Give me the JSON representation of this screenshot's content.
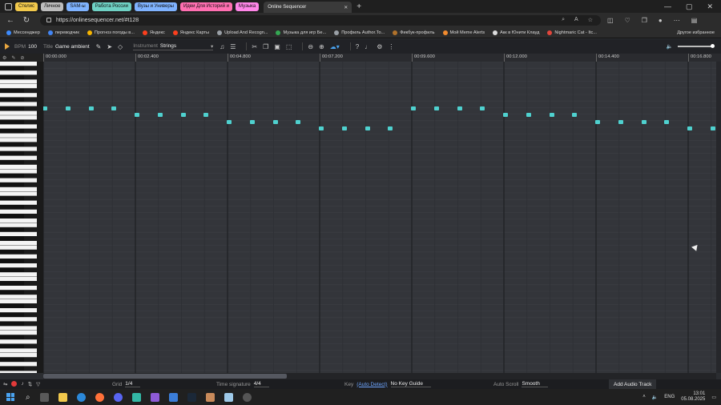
{
  "browser": {
    "tab_groups": [
      {
        "label": "Стелис",
        "color": "#f2c94c"
      },
      {
        "label": "Личное",
        "color": "#bdbdbd"
      },
      {
        "label": "SAM-ы",
        "color": "#7fb3ff"
      },
      {
        "label": "Работа России",
        "color": "#6fd1c4"
      },
      {
        "label": "Вузы и Универы",
        "color": "#7fb3ff"
      },
      {
        "label": "Идеи Для Историй и",
        "color": "#ff6fb1"
      },
      {
        "label": "Музыка",
        "color": "#ff86e8"
      }
    ],
    "active_tab": "Online Sequencer",
    "url": "https://onlinesequencer.net/#t128"
  },
  "bookmarks": [
    {
      "label": "Мессенджер",
      "color": "#3d8bfd"
    },
    {
      "label": "переводчик",
      "color": "#4285f4"
    },
    {
      "label": "Прогноз погоды в...",
      "color": "#f7b500"
    },
    {
      "label": "Яндекс",
      "color": "#fc3f1d"
    },
    {
      "label": "Яндекс Карты",
      "color": "#fc3f1d"
    },
    {
      "label": "Upload And Recogn...",
      "color": "#9aa0a6"
    },
    {
      "label": "Музыка для игр Бе...",
      "color": "#34a853"
    },
    {
      "label": "Профиль Author.To...",
      "color": "#9aa0a6"
    },
    {
      "label": "Фикбук-профиль",
      "color": "#b0722b"
    },
    {
      "label": "Мой Meme Alerts",
      "color": "#f28b2e"
    },
    {
      "label": "Акк в Юнити Клауд",
      "color": "#dddddd"
    },
    {
      "label": "Nightmaric Cat - Itc...",
      "color": "#e2463c"
    }
  ],
  "bookmarks_other": "Другое избранное",
  "sequencer": {
    "bpm_label": "BPM",
    "bpm": "100",
    "title_label": "Title",
    "title": "Game ambient",
    "instrument_label": "Instrument",
    "instrument": "Strings"
  },
  "ruler_labels": [
    "00:00.000",
    "00:02.400",
    "00:04.800",
    "00:07.200",
    "00:09.600",
    "00:12.000",
    "00:14.400",
    "00:16.800"
  ],
  "notes": [
    {
      "beat": 0,
      "row": 0
    },
    {
      "beat": 1,
      "row": 0
    },
    {
      "beat": 2,
      "row": 0
    },
    {
      "beat": 3,
      "row": 0
    },
    {
      "beat": 4,
      "row": 1
    },
    {
      "beat": 5,
      "row": 1
    },
    {
      "beat": 6,
      "row": 1
    },
    {
      "beat": 7,
      "row": 1
    },
    {
      "beat": 8,
      "row": 2
    },
    {
      "beat": 9,
      "row": 2
    },
    {
      "beat": 10,
      "row": 2
    },
    {
      "beat": 11,
      "row": 2
    },
    {
      "beat": 12,
      "row": 3
    },
    {
      "beat": 13,
      "row": 3
    },
    {
      "beat": 14,
      "row": 3
    },
    {
      "beat": 15,
      "row": 3
    },
    {
      "beat": 16,
      "row": 0
    },
    {
      "beat": 17,
      "row": 0
    },
    {
      "beat": 18,
      "row": 0
    },
    {
      "beat": 19,
      "row": 0
    },
    {
      "beat": 20,
      "row": 1
    },
    {
      "beat": 21,
      "row": 1
    },
    {
      "beat": 22,
      "row": 1
    },
    {
      "beat": 23,
      "row": 1
    },
    {
      "beat": 24,
      "row": 2
    },
    {
      "beat": 25,
      "row": 2
    },
    {
      "beat": 26,
      "row": 2
    },
    {
      "beat": 27,
      "row": 2
    },
    {
      "beat": 28,
      "row": 3
    },
    {
      "beat": 29,
      "row": 3
    }
  ],
  "note_color": "#4fd1cf",
  "status": {
    "grid_label": "Grid",
    "grid": "1/4",
    "time_sig_label": "Time signature",
    "time_sig": "4/4",
    "key_label": "Key",
    "key_link": "(Auto Detect)",
    "key_value": "No Key Guide",
    "autoscroll_label": "Auto Scroll",
    "autoscroll": "Smooth",
    "add_audio": "Add Audio Track"
  },
  "taskbar": {
    "lang": "ENG",
    "time": "13:01",
    "date": "05.08.2025"
  }
}
